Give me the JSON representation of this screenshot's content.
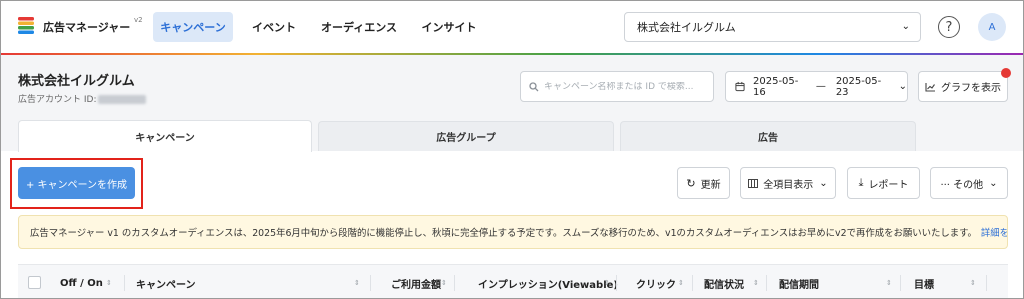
{
  "header": {
    "app_title": "広告マネージャー",
    "version": "v2",
    "nav": [
      {
        "label": "キャンペーン",
        "active": true
      },
      {
        "label": "イベント",
        "active": false
      },
      {
        "label": "オーディエンス",
        "active": false
      },
      {
        "label": "インサイト",
        "active": false
      }
    ],
    "account_select": "株式会社イルグルム",
    "help_icon": "?",
    "avatar": "A"
  },
  "account": {
    "name": "株式会社イルグルム",
    "id_label": "広告アカウント ID:"
  },
  "search": {
    "placeholder": "キャンペーン名称または ID で検索..."
  },
  "date_range": {
    "start": "2025-05-16",
    "separator": "—",
    "end": "2025-05-23"
  },
  "chart_button": "グラフを表示",
  "tabs": [
    {
      "label": "キャンペーン",
      "active": true
    },
    {
      "label": "広告グループ",
      "active": false
    },
    {
      "label": "広告",
      "active": false
    }
  ],
  "toolbar": {
    "create": "+ キャンペーンを作成",
    "refresh": "更新",
    "columns": "全項目表示",
    "report": "レポート",
    "more": "··· その他"
  },
  "notice": {
    "text": "広告マネージャー v1 のカスタムオーディエンスは、2025年6月中旬から段階的に機能停止し、秋頃に完全停止する予定です。スムーズな移行のため、v1のカスタムオーディエンスはお早めにv2で再作成をお願いいたします。",
    "link": "詳細を見る"
  },
  "table": {
    "columns": [
      "Off / On",
      "キャンペーン",
      "ご利用金額",
      "インプレッション(Viewable)",
      "クリック",
      "配信状況",
      "配信期間",
      "目標"
    ]
  },
  "colors": {
    "accent": "#4a90e2",
    "nav_active_bg": "#dce8f8",
    "nav_active_text": "#2c6fd6",
    "notice_bg": "#fff8e1",
    "highlight": "#e2231a",
    "alert_dot": "#e53935"
  }
}
